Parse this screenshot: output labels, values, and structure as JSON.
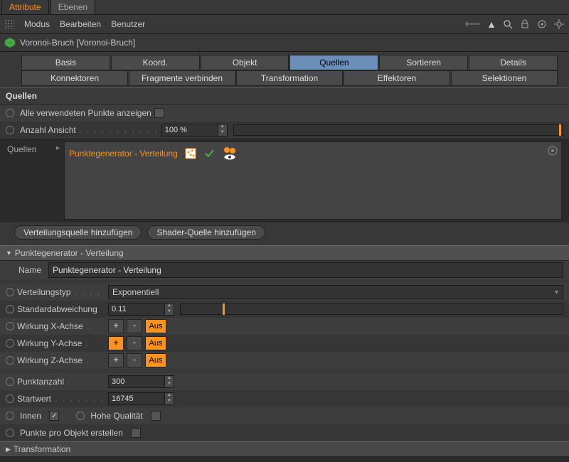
{
  "tabs": {
    "attribute": "Attribute",
    "ebenen": "Ebenen"
  },
  "menu": {
    "modus": "Modus",
    "bearbeiten": "Bearbeiten",
    "benutzer": "Benutzer"
  },
  "object": {
    "name": "Voronoi-Bruch [Voronoi-Bruch]"
  },
  "nav": {
    "row1": [
      "Basis",
      "Koord.",
      "Objekt",
      "Quellen",
      "Sortieren",
      "Details"
    ],
    "row2": [
      "Konnektoren",
      "Fragmente verbinden",
      "Transformation",
      "Effektoren",
      "Selektionen"
    ]
  },
  "section": {
    "quellen": "Quellen"
  },
  "fields": {
    "showAll": "Alle verwendeten Punkte anzeigen",
    "anzahl": "Anzahl Ansicht",
    "anzahlVal": "100 %",
    "quellen": "Quellen",
    "srcItem": "Punktegenerator - Verteilung",
    "addDist": "Verteilungsquelle hinzufügen",
    "addShader": "Shader-Quelle hinzufügen",
    "gen": "Punktegenerator - Verteilung",
    "name": "Name",
    "nameVal": "Punktegenerator - Verteilung",
    "typ": "Verteilungstyp",
    "typVal": "Exponentiell",
    "std": "Standardabweichung",
    "stdVal": "0.11",
    "wx": "Wirkung X-Achse",
    "wy": "Wirkung Y-Achse",
    "wz": "Wirkung Z-Achse",
    "plus": "+",
    "minus": "-",
    "aus": "Aus",
    "punkt": "Punktanzahl",
    "punktVal": "300",
    "start": "Startwert",
    "startVal": "16745",
    "innen": "Innen",
    "hq": "Hohe Qualität",
    "ppo": "Punkte pro Objekt erstellen",
    "trans": "Transformation"
  }
}
